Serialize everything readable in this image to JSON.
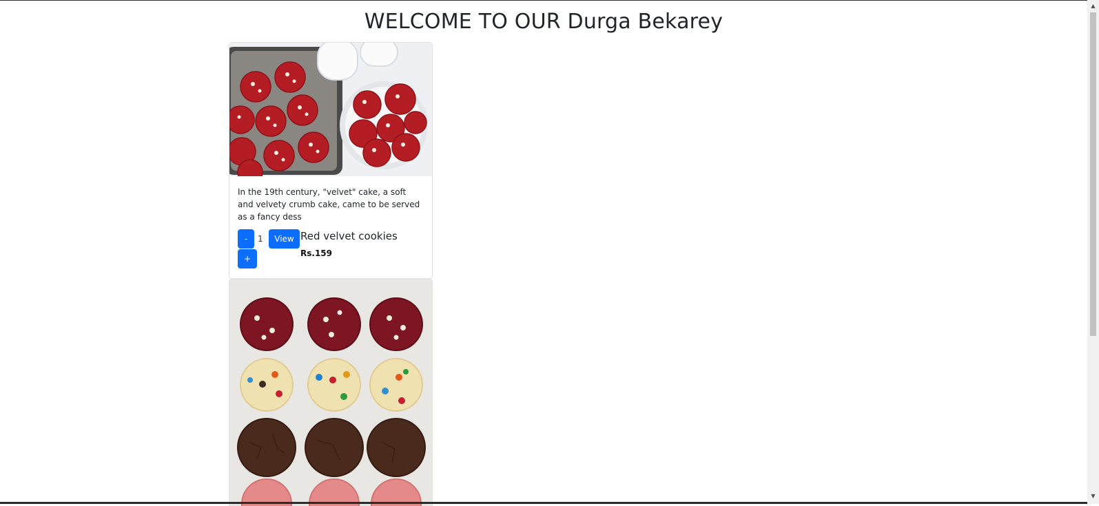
{
  "page": {
    "title": "WELCOME TO OUR Durga Bekarey"
  },
  "products": [
    {
      "image": "red-velvet-cookies-photo",
      "description": "In the 19th century, \"velvet\" cake, a soft and velvety crumb cake, came to be served as a fancy dess",
      "minus_label": "-",
      "quantity": "1",
      "view_label": "View",
      "plus_label": "+",
      "name": "Red velvet cookies",
      "price": "Rs.159"
    },
    {
      "image": "assorted-cookies-photo"
    }
  ],
  "colors": {
    "primary_button": "#0d6efd",
    "card_border": "#dee2e6"
  },
  "icons": {
    "scroll_up": "triangle-up",
    "scroll_down": "triangle-down"
  }
}
